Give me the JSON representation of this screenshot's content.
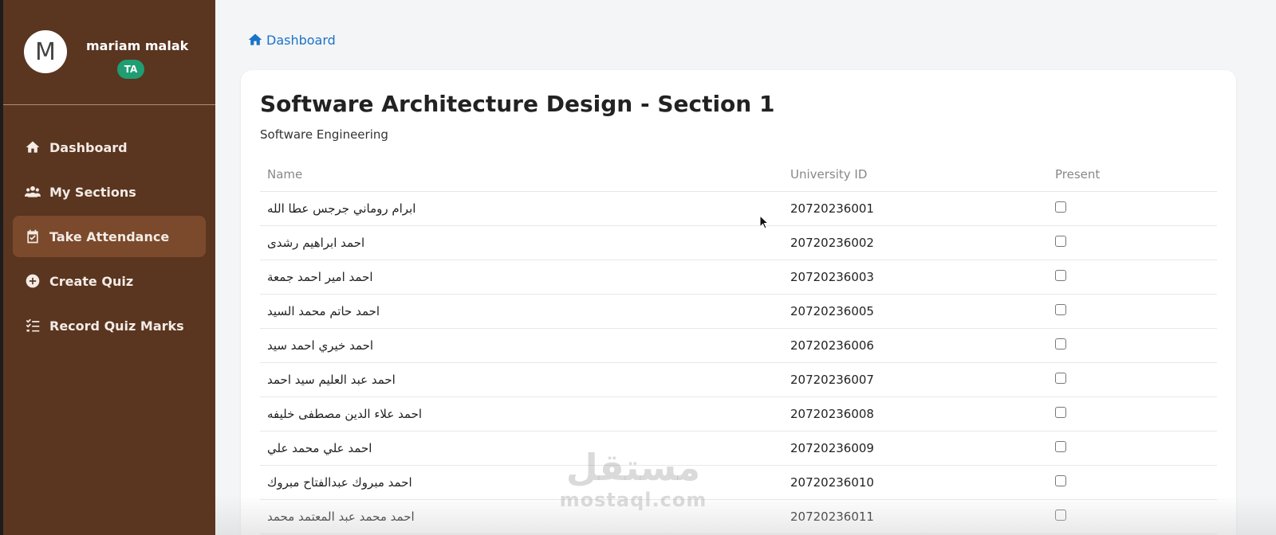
{
  "profile": {
    "avatar_letter": "M",
    "name": "mariam malak",
    "role": "TA"
  },
  "nav": {
    "items": [
      {
        "label": "Dashboard",
        "icon": "home-icon"
      },
      {
        "label": "My Sections",
        "icon": "users-icon"
      },
      {
        "label": "Take Attendance",
        "icon": "calendar-check-icon",
        "active": true
      },
      {
        "label": "Create Quiz",
        "icon": "plus-circle-icon"
      },
      {
        "label": "Record Quiz Marks",
        "icon": "list-check-icon"
      }
    ]
  },
  "breadcrumb": {
    "label": "Dashboard"
  },
  "section": {
    "title": "Software Architecture Design - Section 1",
    "subtitle": "Software Engineering"
  },
  "table": {
    "headers": {
      "name": "Name",
      "id": "University ID",
      "present": "Present"
    },
    "rows": [
      {
        "name": "ابرام روماني جرجس عطا الله",
        "id": "20720236001"
      },
      {
        "name": "احمد ابراهيم رشدى",
        "id": "20720236002"
      },
      {
        "name": "احمد امير احمد جمعة",
        "id": "20720236003"
      },
      {
        "name": "احمد حاتم محمد السيد",
        "id": "20720236005"
      },
      {
        "name": "احمد خيري احمد سيد",
        "id": "20720236006"
      },
      {
        "name": "احمد عبد العليم سيد احمد",
        "id": "20720236007"
      },
      {
        "name": "احمد علاء الدين مصطفى خليفه",
        "id": "20720236008"
      },
      {
        "name": "احمد علي محمد علي",
        "id": "20720236009"
      },
      {
        "name": "احمد مبروك عبدالفتاح مبروك",
        "id": "20720236010"
      },
      {
        "name": "احمد محمد عبد المعتمد محمد",
        "id": "20720236011"
      }
    ]
  },
  "watermark": {
    "arabic": "مستقل",
    "latin": "mostaql.com"
  },
  "colors": {
    "sidebar": "#5a3520",
    "active": "#7b4a2c",
    "badge": "#1e9e72",
    "link": "#1a73c8"
  }
}
